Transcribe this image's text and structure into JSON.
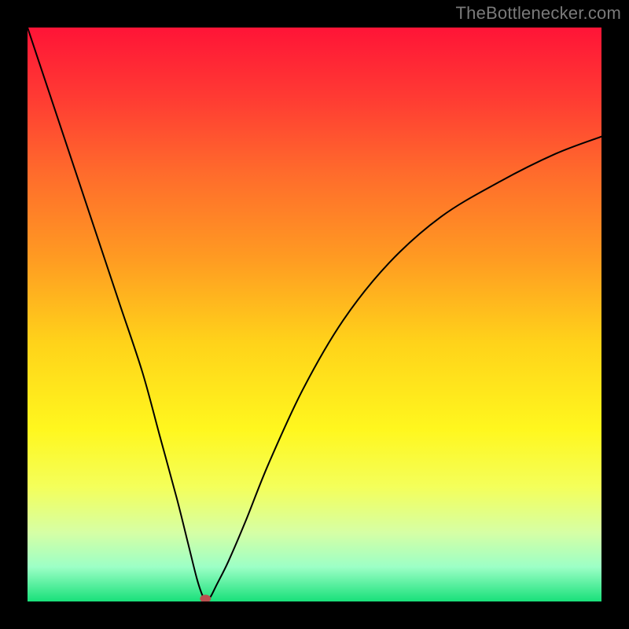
{
  "watermark": "TheBottlenecker.com",
  "chart_data": {
    "type": "line",
    "title": "",
    "xlabel": "",
    "ylabel": "",
    "xlim": [
      0,
      100
    ],
    "ylim": [
      0,
      100
    ],
    "background": {
      "type": "vertical-gradient",
      "stops": [
        {
          "offset": 0.0,
          "color": "#ff1437"
        },
        {
          "offset": 0.12,
          "color": "#ff3a33"
        },
        {
          "offset": 0.25,
          "color": "#ff6a2c"
        },
        {
          "offset": 0.4,
          "color": "#ff9a22"
        },
        {
          "offset": 0.55,
          "color": "#ffd31a"
        },
        {
          "offset": 0.7,
          "color": "#fff71e"
        },
        {
          "offset": 0.8,
          "color": "#f4ff5a"
        },
        {
          "offset": 0.88,
          "color": "#d6ffa5"
        },
        {
          "offset": 0.94,
          "color": "#9cffc6"
        },
        {
          "offset": 1.0,
          "color": "#18e07a"
        }
      ]
    },
    "series": [
      {
        "name": "bottleneck-curve",
        "color": "#000000",
        "width": 2,
        "x": [
          0,
          4,
          8,
          12,
          16,
          20,
          23,
          26,
          28,
          29.5,
          30.5,
          31,
          31.5,
          32,
          33,
          35,
          38,
          42,
          48,
          55,
          63,
          72,
          82,
          92,
          100
        ],
        "values": [
          100,
          88,
          76,
          64,
          52,
          40,
          29,
          18,
          10,
          4,
          1,
          0.5,
          0.5,
          1,
          3,
          7,
          14,
          24,
          37,
          49,
          59,
          67,
          73,
          78,
          81
        ]
      }
    ],
    "marker": {
      "name": "minimum-point",
      "x": 31,
      "y": 0.5,
      "rx": 7,
      "ry": 5,
      "fill": "#b94f4f"
    }
  }
}
